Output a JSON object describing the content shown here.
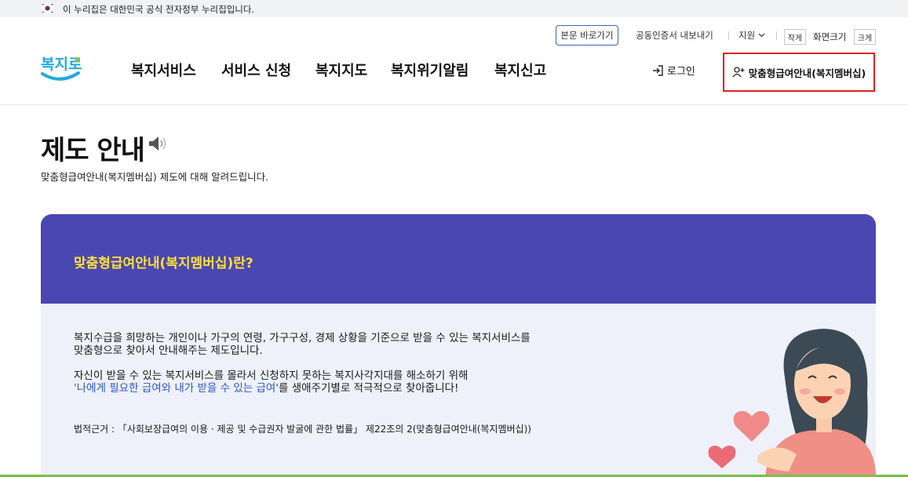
{
  "gov_banner": {
    "text": "이 누리집은 대한민국 공식 전자정부 누리집입니다."
  },
  "utility": {
    "skip_label": "본문 바로가기",
    "cert_label": "공동인증서 내보내기",
    "support_label": "지원",
    "size_small": "작게",
    "size_label": "화면크기",
    "size_large": "크게"
  },
  "logo": {
    "text": "복지로"
  },
  "nav": [
    "복지서비스",
    "서비스 신청",
    "복지지도",
    "복지위기알림",
    "복지신고"
  ],
  "header_right": {
    "login": "로그인",
    "member": "맞춤형급여안내(복지멤버십)"
  },
  "page": {
    "title": "제도 안내",
    "desc": "맞춤형급여안내(복지멤버십) 제도에 대해 알려드립니다."
  },
  "card": {
    "title": "맞춤형급여안내(복지멤버십)란?",
    "p1_line1": "복지수급을 희망하는 개인이나 가구의 연령, 가구구성, 경제 상황을 기준으로 받을 수 있는 복지서비스를",
    "p1_line2": "맞춤형으로 찾아서 안내해주는 제도입니다.",
    "p2_line1": "자신이 받을 수 있는 복지서비스를 몰라서 신청하지 못하는 복지사각지대를 해소하기 위해",
    "p2_highlight": "'나에게 필요한 급여와 내가 받을 수 있는 급여'",
    "p2_rest": "를 생애주기별로 적극적으로 찾아줍니다!",
    "law": "법적근거 : 「사회보장급여의 이용 · 제공 및 수급권자 발굴에 관한 법률」 제22조의 2(맞춤형급여안내(복지멤버십))"
  },
  "colors": {
    "card_header": "#4a47b2",
    "card_title": "#ffe135",
    "card_body": "#eef1fa",
    "highlight": "#2d56c9",
    "member_border": "#e02020"
  }
}
